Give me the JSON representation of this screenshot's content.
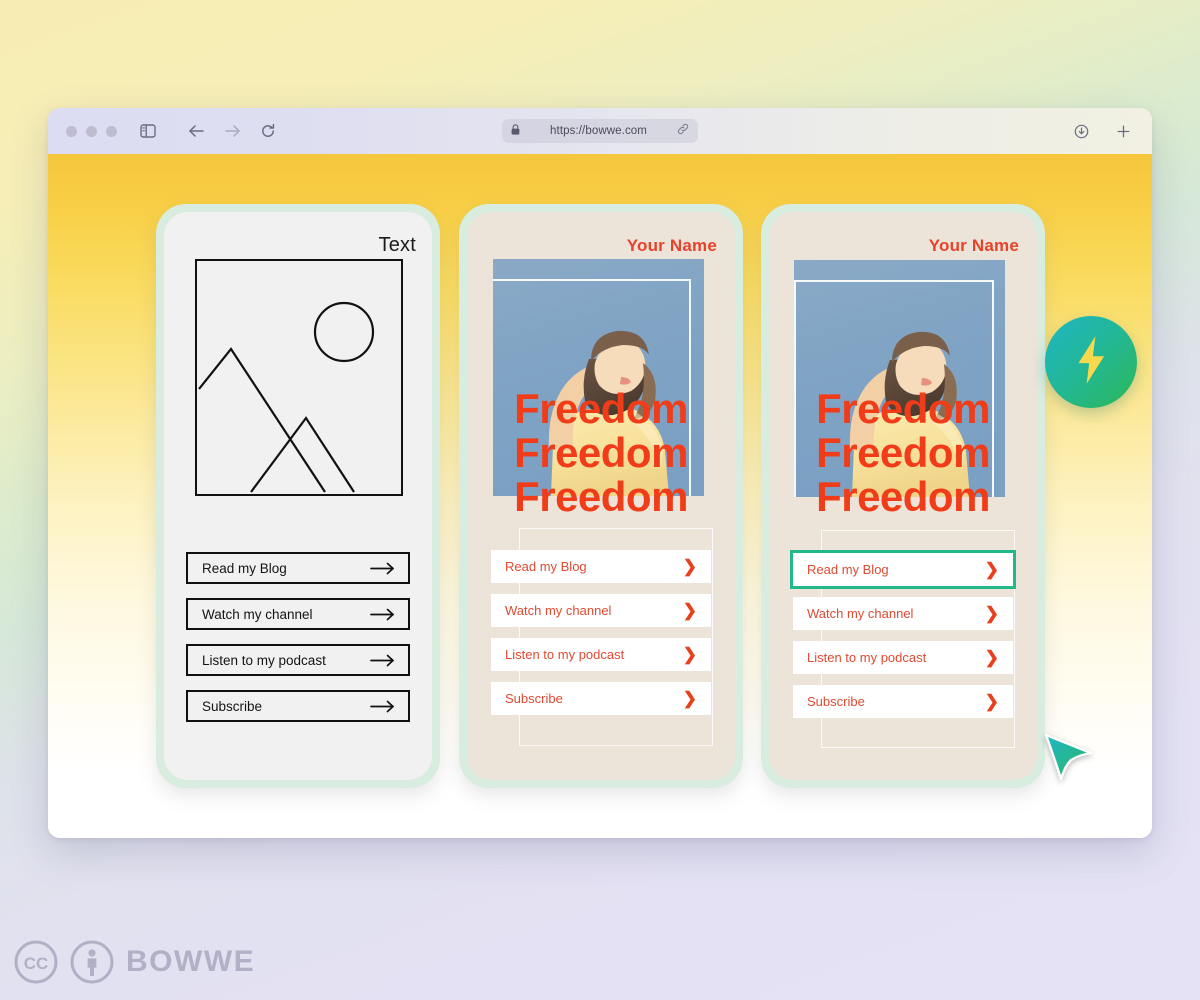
{
  "browser": {
    "url": "https://bowwe.com",
    "lock_icon": "lock-icon",
    "link_icon": "link-icon",
    "back_icon": "back-arrow-icon",
    "forward_icon": "forward-arrow-icon",
    "reload_icon": "reload-icon",
    "sidebar_icon": "sidebar-toggle-icon",
    "download_icon": "download-icon",
    "newtab_icon": "new-tab-icon",
    "traffic_lights": [
      "close",
      "minimize",
      "maximize"
    ]
  },
  "page": {
    "background_top_color": "#f6c63c",
    "background_bottom_color": "#ffffff"
  },
  "badge": {
    "icon": "lightning-bolt-icon",
    "gradient_from": "#1fb6c4",
    "gradient_to": "#2cb757",
    "bolt_color": "#f7d94e"
  },
  "cursor": {
    "icon": "cursor-pointer-icon",
    "gradient_from": "#1fb6c4",
    "gradient_to": "#2cb757"
  },
  "cards": [
    {
      "id": "card-wireframe",
      "title": "Text",
      "title_color": "#1b1b1b",
      "body_color": "#f1f1f1",
      "border_color": "#d9ece0",
      "media": "image-placeholder-icon",
      "button_style": "outline",
      "buttons": [
        {
          "label": "Read my Blog",
          "icon": "arrow-right-icon",
          "active": false
        },
        {
          "label": "Watch my channel",
          "icon": "arrow-right-icon",
          "active": false
        },
        {
          "label": "Listen to my podcast",
          "icon": "arrow-right-icon",
          "active": false
        },
        {
          "label": "Subscribe",
          "icon": "arrow-right-icon",
          "active": false
        }
      ]
    },
    {
      "id": "card-preview",
      "title": "Your Name",
      "title_color": "#e8432a",
      "body_color": "#ece4d8",
      "border_color": "#d9ece0",
      "media": "photo-woman-sky",
      "overlay_lines": [
        "Freedom",
        "Freedom",
        "Freedom"
      ],
      "overlay_color": "#f03c18",
      "button_style": "filled",
      "buttons": [
        {
          "label": "Read my Blog",
          "icon": "chevron-right-icon",
          "active": false
        },
        {
          "label": "Watch my channel",
          "icon": "chevron-right-icon",
          "active": false
        },
        {
          "label": "Listen to my podcast",
          "icon": "chevron-right-icon",
          "active": false
        },
        {
          "label": "Subscribe",
          "icon": "chevron-right-icon",
          "active": false
        }
      ]
    },
    {
      "id": "card-selected",
      "title": "Your Name",
      "title_color": "#e8432a",
      "body_color": "#ece4d8",
      "border_color": "#d9ece0",
      "media": "photo-woman-sky",
      "overlay_lines": [
        "Freedom",
        "Freedom",
        "Freedom"
      ],
      "overlay_color": "#f03c18",
      "button_style": "filled",
      "highlight_color": "#21b98a",
      "buttons": [
        {
          "label": "Read my Blog",
          "icon": "chevron-right-icon",
          "active": true
        },
        {
          "label": "Watch my channel",
          "icon": "chevron-right-icon",
          "active": false
        },
        {
          "label": "Listen to my podcast",
          "icon": "chevron-right-icon",
          "active": false
        },
        {
          "label": "Subscribe",
          "icon": "chevron-right-icon",
          "active": false
        }
      ]
    }
  ],
  "footer": {
    "cc_icon": "creative-commons-icon",
    "by_icon": "creative-commons-by-icon",
    "brand": "BOWWE"
  }
}
